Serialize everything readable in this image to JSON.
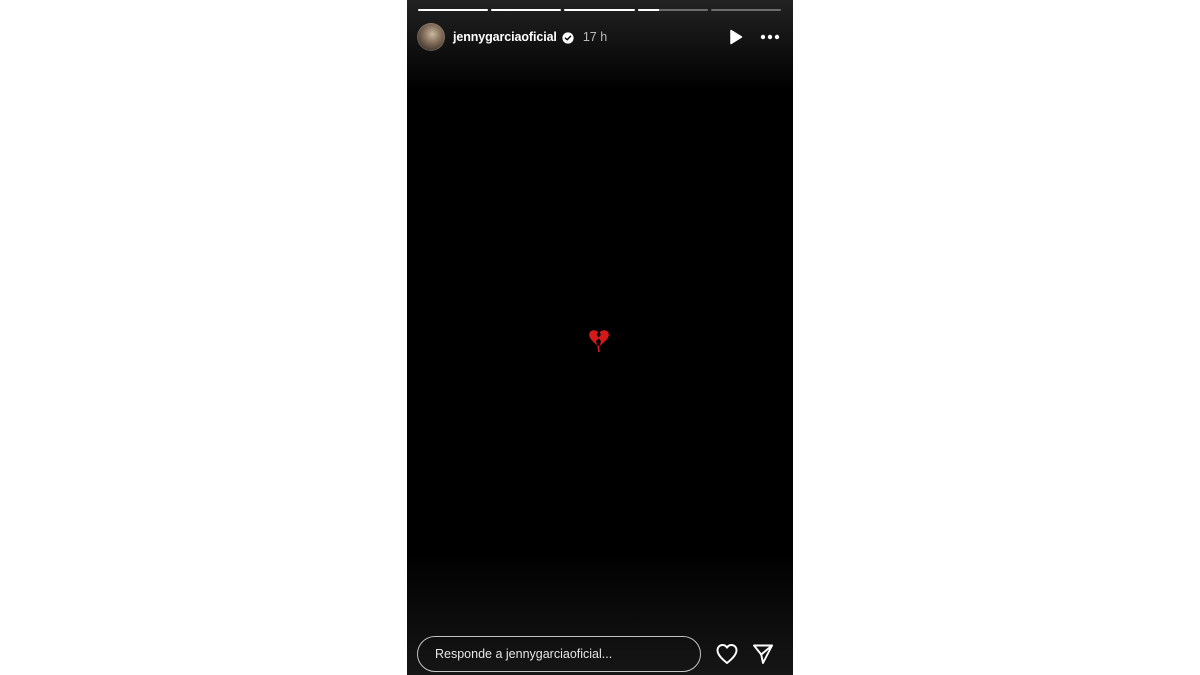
{
  "story": {
    "progress": [
      1,
      1,
      1,
      0.3,
      0
    ],
    "user": {
      "username": "jennygarciaoficial",
      "verified": true,
      "time_ago": "17 h",
      "avatar_icon": "profile-photo"
    },
    "controls": {
      "play_icon": "play-icon",
      "more_icon": "more-options-icon"
    },
    "content": {
      "emoji_icon": "broken-heart-icon",
      "emoji_color": "#d21a1a"
    },
    "footer": {
      "reply_placeholder": "Responde a jennygarciaoficial...",
      "like_icon": "heart-icon",
      "send_icon": "send-icon"
    }
  }
}
